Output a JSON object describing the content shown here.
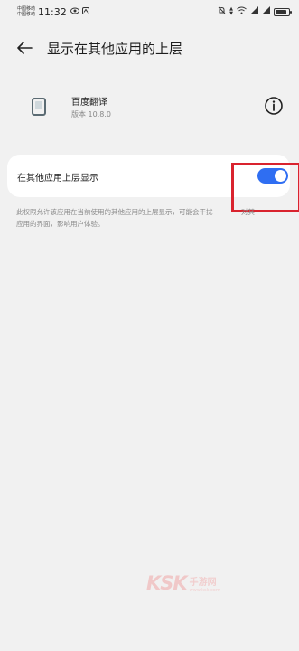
{
  "status_bar": {
    "carrier_1": "中国移动",
    "carrier_2": "中国移动",
    "time": "11:32",
    "left_icons": [
      "eye-icon",
      "notification-icon"
    ],
    "right_icons": [
      "mute-icon",
      "network-speed",
      "wifi-icon",
      "signal-icon",
      "signal-icon",
      "battery-icon"
    ]
  },
  "header": {
    "title": "显示在其他应用的上层",
    "back_icon": "arrow-left-icon"
  },
  "app": {
    "name": "百度翻译",
    "version": "版本 10.8.0",
    "info_icon": "info-icon"
  },
  "setting": {
    "label": "在其他应用上层显示",
    "enabled": true,
    "accent_color": "#2f6ef2"
  },
  "description": {
    "line1": "此权限允许该应用在当前使用的其他应用的上层显示，可能会干扰",
    "line1_tail": "对其",
    "line2": "应用的界面，影响用户体验。"
  },
  "annotation": {
    "color": "#d9232e"
  },
  "watermark": {
    "brand": "KSK",
    "label": "手游网",
    "url": "www.ksk.com"
  }
}
